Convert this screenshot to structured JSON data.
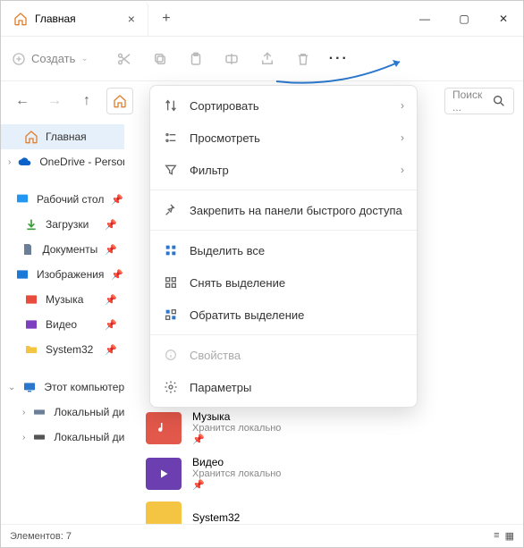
{
  "tab": {
    "title": "Главная"
  },
  "toolbar": {
    "create": "Создать"
  },
  "search": {
    "placeholder": "Поиск ..."
  },
  "sidebar": {
    "home": "Главная",
    "onedrive": "OneDrive - Personal",
    "desktop": "Рабочий стол",
    "downloads": "Загрузки",
    "documents": "Документы",
    "pictures": "Изображения",
    "music": "Музыка",
    "videos": "Видео",
    "system32": "System32",
    "thispc": "Этот компьютер",
    "localdisk1": "Локальный диск",
    "localdisk2": "Локальный диск"
  },
  "menu": {
    "sort": "Сортировать",
    "view": "Просмотреть",
    "filter": "Фильтр",
    "pin": "Закрепить на панели быстрого доступа",
    "selectall": "Выделить все",
    "deselect": "Снять выделение",
    "invert": "Обратить выделение",
    "properties": "Свойства",
    "options": "Параметры"
  },
  "files": {
    "music": {
      "name": "Музыка",
      "sub": "Хранится локально"
    },
    "video": {
      "name": "Видео",
      "sub": "Хранится локально"
    },
    "system32": {
      "name": "System32"
    }
  },
  "status": {
    "count": "Элементов: 7"
  }
}
